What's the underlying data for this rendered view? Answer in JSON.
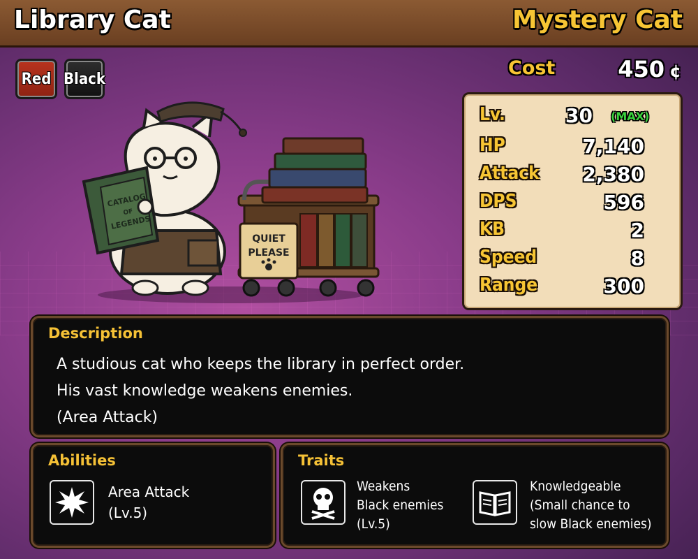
{
  "header": {
    "unit_name": "Library Cat",
    "rarity": "Mystery Cat"
  },
  "tags": [
    {
      "label": "Red",
      "color": "#b8331e"
    },
    {
      "label": "Black",
      "color": "#1e1e1e"
    }
  ],
  "cost": {
    "label": "Cost",
    "value": "450",
    "unit": "¢"
  },
  "stats": {
    "level": {
      "label": "Lv.",
      "value": "30",
      "max_badge": "(MAX)"
    },
    "rows": [
      {
        "label": "HP",
        "value": "7,140"
      },
      {
        "label": "Attack",
        "value": "2,380"
      },
      {
        "label": "DPS",
        "value": "596"
      },
      {
        "label": "KB",
        "value": "2"
      },
      {
        "label": "Speed",
        "value": "8"
      },
      {
        "label": "Range",
        "value": "300"
      }
    ]
  },
  "illustration": {
    "book_text": [
      "CATALOG",
      "OF",
      "LEGENDS"
    ],
    "sign_text": [
      "QUIET",
      "PLEASE"
    ]
  },
  "description": {
    "title": "Description",
    "lines": [
      "A studious cat who keeps the library in perfect order.",
      "His vast knowledge weakens enemies.",
      "(Area Attack)"
    ]
  },
  "abilities": {
    "title": "Abilities",
    "items": [
      {
        "icon": "area-attack-icon",
        "lines": [
          "Area Attack",
          "(Lv.5)"
        ]
      }
    ]
  },
  "traits": {
    "title": "Traits",
    "items": [
      {
        "icon": "skull-icon",
        "lines": [
          "Weakens",
          "Black enemies",
          "(Lv.5)"
        ]
      },
      {
        "icon": "book-icon",
        "lines": [
          "Knowledgeable",
          "(Small chance to",
          "slow Black enemies)"
        ]
      }
    ]
  },
  "colors": {
    "accent_gold": "#f7c534",
    "max_green": "#39d13c",
    "stats_bg": "#f2ddb9",
    "header_brown": "#7a4a29"
  }
}
